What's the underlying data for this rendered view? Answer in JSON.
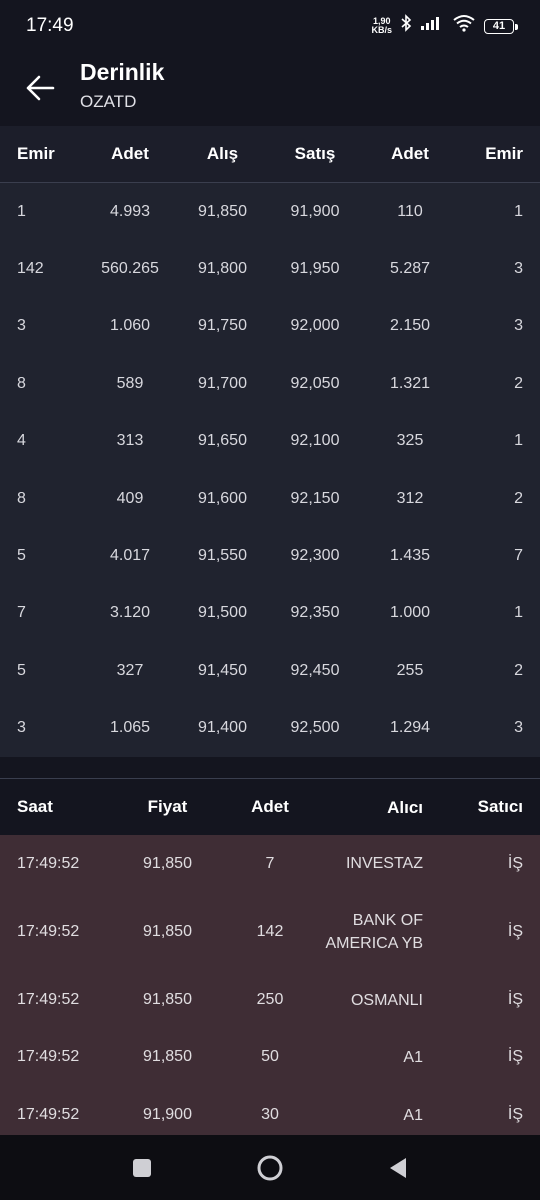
{
  "status": {
    "time": "17:49",
    "net_speed_value": "1,90",
    "net_speed_unit": "KB/s",
    "battery": "41",
    "icons": [
      "bluetooth-icon",
      "signal-icon",
      "wifi-icon",
      "battery-icon"
    ]
  },
  "header": {
    "title": "Derinlik",
    "subtitle": "OZATD",
    "back_icon": "arrow-left-icon"
  },
  "depth": {
    "columns": [
      "Emir",
      "Adet",
      "Alış",
      "Satış",
      "Adet",
      "Emir"
    ],
    "rows": [
      [
        "1",
        "4.993",
        "91,850",
        "91,900",
        "110",
        "1"
      ],
      [
        "142",
        "560.265",
        "91,800",
        "91,950",
        "5.287",
        "3"
      ],
      [
        "3",
        "1.060",
        "91,750",
        "92,000",
        "2.150",
        "3"
      ],
      [
        "8",
        "589",
        "91,700",
        "92,050",
        "1.321",
        "2"
      ],
      [
        "4",
        "313",
        "91,650",
        "92,100",
        "325",
        "1"
      ],
      [
        "8",
        "409",
        "91,600",
        "92,150",
        "312",
        "2"
      ],
      [
        "5",
        "4.017",
        "91,550",
        "92,300",
        "1.435",
        "7"
      ],
      [
        "7",
        "3.120",
        "91,500",
        "92,350",
        "1.000",
        "1"
      ],
      [
        "5",
        "327",
        "91,450",
        "92,450",
        "255",
        "2"
      ],
      [
        "3",
        "1.065",
        "91,400",
        "92,500",
        "1.294",
        "3"
      ]
    ]
  },
  "trades": {
    "columns": [
      "Saat",
      "Fiyat",
      "Adet",
      "Alıcı",
      "Satıcı"
    ],
    "rows": [
      {
        "time": "17:49:52",
        "price": "91,850",
        "qty": "7",
        "buyer": [
          "INVESTAZ"
        ],
        "seller": "İŞ"
      },
      {
        "time": "17:49:52",
        "price": "91,850",
        "qty": "142",
        "buyer": [
          "BANK OF",
          "AMERICA YB"
        ],
        "seller": "İŞ"
      },
      {
        "time": "17:49:52",
        "price": "91,850",
        "qty": "250",
        "buyer": [
          "OSMANLI"
        ],
        "seller": "İŞ"
      },
      {
        "time": "17:49:52",
        "price": "91,850",
        "qty": "50",
        "buyer": [
          "A1"
        ],
        "seller": "İŞ"
      },
      {
        "time": "17:49:52",
        "price": "91,900",
        "qty": "30",
        "buyer": [
          "A1"
        ],
        "seller": "İŞ"
      }
    ]
  },
  "navbar": {
    "icons": [
      "recents-square-icon",
      "home-circle-icon",
      "back-triangle-icon"
    ]
  }
}
